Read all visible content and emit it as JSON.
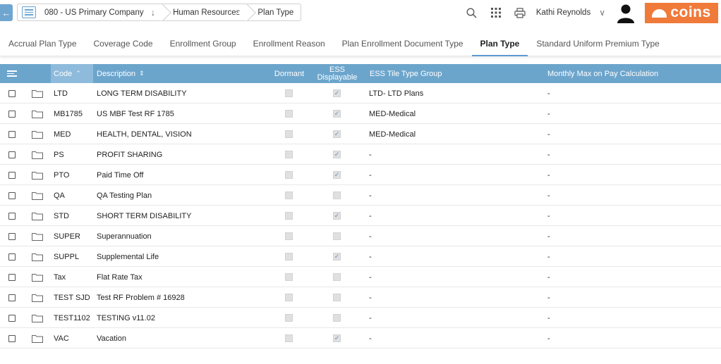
{
  "breadcrumb": {
    "company": "080 - US Primary Company",
    "module": "Human Resources",
    "page": "Plan Type"
  },
  "user": {
    "name": "Kathi Reynolds"
  },
  "brand": {
    "logo_text": "coins",
    "accent": "#f07a3a",
    "header_blue": "#6ca5cc"
  },
  "icons": [
    "back-arrow-icon",
    "list-icon",
    "chevron-down-icon",
    "search-icon",
    "apps-grid-icon",
    "print-icon",
    "user-avatar-icon",
    "folder-icon",
    "checkbox-icon",
    "menu-icon",
    "sort-icon"
  ],
  "tabs": [
    {
      "label": "Accrual Plan Type",
      "active": false
    },
    {
      "label": "Coverage Code",
      "active": false
    },
    {
      "label": "Enrollment Group",
      "active": false
    },
    {
      "label": "Enrollment Reason",
      "active": false
    },
    {
      "label": "Plan Enrollment Document Type",
      "active": false
    },
    {
      "label": "Plan Type",
      "active": true
    },
    {
      "label": "Standard Uniform Premium Type",
      "active": false
    }
  ],
  "grid": {
    "columns": {
      "code": "Code",
      "description": "Description",
      "dormant": "Dormant",
      "ess_line1": "ESS",
      "ess_line2": "Displayable",
      "tile_group": "ESS Tile Type Group",
      "monthly_max": "Monthly Max on Pay Calculation"
    },
    "rows": [
      {
        "code": "LTD",
        "description": "LONG TERM DISABILITY",
        "dormant": false,
        "ess": true,
        "tile_group": "LTD- LTD Plans",
        "monthly_max": "-"
      },
      {
        "code": "MB1785",
        "description": "US MBF Test RF 1785",
        "dormant": false,
        "ess": true,
        "tile_group": "MED-Medical",
        "monthly_max": "-"
      },
      {
        "code": "MED",
        "description": "HEALTH, DENTAL, VISION",
        "dormant": false,
        "ess": true,
        "tile_group": "MED-Medical",
        "monthly_max": "-"
      },
      {
        "code": "PS",
        "description": "PROFIT SHARING",
        "dormant": false,
        "ess": true,
        "tile_group": "-",
        "monthly_max": "-"
      },
      {
        "code": "PTO",
        "description": "Paid Time Off",
        "dormant": false,
        "ess": true,
        "tile_group": "-",
        "monthly_max": "-"
      },
      {
        "code": "QA",
        "description": "QA Testing Plan",
        "dormant": false,
        "ess": false,
        "tile_group": "-",
        "monthly_max": "-"
      },
      {
        "code": "STD",
        "description": "SHORT TERM DISABILITY",
        "dormant": false,
        "ess": true,
        "tile_group": "-",
        "monthly_max": "-"
      },
      {
        "code": "SUPER",
        "description": "Superannuation",
        "dormant": false,
        "ess": false,
        "tile_group": "-",
        "monthly_max": "-"
      },
      {
        "code": "SUPPL",
        "description": "Supplemental Life",
        "dormant": false,
        "ess": true,
        "tile_group": "-",
        "monthly_max": "-"
      },
      {
        "code": "Tax",
        "description": "Flat Rate Tax",
        "dormant": false,
        "ess": false,
        "tile_group": "-",
        "monthly_max": "-"
      },
      {
        "code": "TEST SJD",
        "description": "Test RF Problem # 16928",
        "dormant": false,
        "ess": false,
        "tile_group": "-",
        "monthly_max": "-"
      },
      {
        "code": "TEST1102",
        "description": "TESTING v11.02",
        "dormant": false,
        "ess": false,
        "tile_group": "-",
        "monthly_max": "-"
      },
      {
        "code": "VAC",
        "description": "Vacation",
        "dormant": false,
        "ess": true,
        "tile_group": "-",
        "monthly_max": "-"
      }
    ]
  }
}
